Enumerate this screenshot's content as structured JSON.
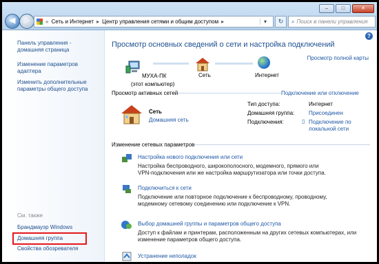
{
  "window": {
    "buttons": {
      "minimize": "–",
      "maximize": "□",
      "close": "✕"
    }
  },
  "address": {
    "back": "◀",
    "forward": "▶",
    "path_root": "«",
    "path_1": "Сеть и Интернет",
    "path_2": "Центр управления сетями и общим доступом",
    "separator": "▸",
    "search_placeholder": "Поиск в панели управления"
  },
  "sidebar": {
    "items": [
      {
        "label_1": "Панель управления -",
        "label_2": "домашняя страница"
      },
      {
        "label_1": "Изменение параметров",
        "label_2": "адаптера"
      },
      {
        "label_1": "Изменить дополнительные",
        "label_2": "параметры общего доступа"
      }
    ],
    "see_also": "См. также",
    "see_also_items": [
      "Брандмауэр Windows",
      "Домашняя группа",
      "Свойства обозревателя"
    ]
  },
  "main": {
    "title": "Просмотр основных сведений о сети и настройка подключений",
    "full_map": "Просмотр полной карты",
    "map": {
      "computer": "МУХА-ПК",
      "computer_sub": "(этот компьютер)",
      "network": "Сеть",
      "internet": "Интернет"
    },
    "active_networks": "Просмотр активных сетей",
    "connect_disconnect": "Подключение или отключение",
    "network_name": "Сеть",
    "network_type": "Домашняя сеть",
    "props": [
      {
        "key": "Тип доступа:",
        "value": "Интернет"
      },
      {
        "key": "Домашняя группа:",
        "value": "Присоединен"
      },
      {
        "key": "Подключения:",
        "value_1": "Подключение по",
        "value_2": "локальной сети"
      }
    ],
    "change_settings": "Изменение сетевых параметров",
    "tasks": [
      {
        "title": "Настройка нового подключения или сети",
        "desc_1": "Настройка беспроводного, широкополосного, модемного, прямого или",
        "desc_2": "VPN-подключения или же настройка маршрутизатора или точки доступа."
      },
      {
        "title": "Подключиться к сети",
        "desc_1": "Подключение или повторное подключение к беспроводному, проводному,",
        "desc_2": "модемному сетевому соединению или подключение к VPN."
      },
      {
        "title": "Выбор домашней группы и параметров общего доступа",
        "desc_1": "Доступ к файлам и принтерам, расположенным на других сетевых компьютерах, или",
        "desc_2": "изменение параметров общего доступа."
      },
      {
        "title": "Устранение неполадок"
      }
    ],
    "help": "?"
  },
  "colors": {
    "highlight_box": "#e5161b",
    "link": "#1e57a6",
    "title": "#1c4f8f"
  }
}
